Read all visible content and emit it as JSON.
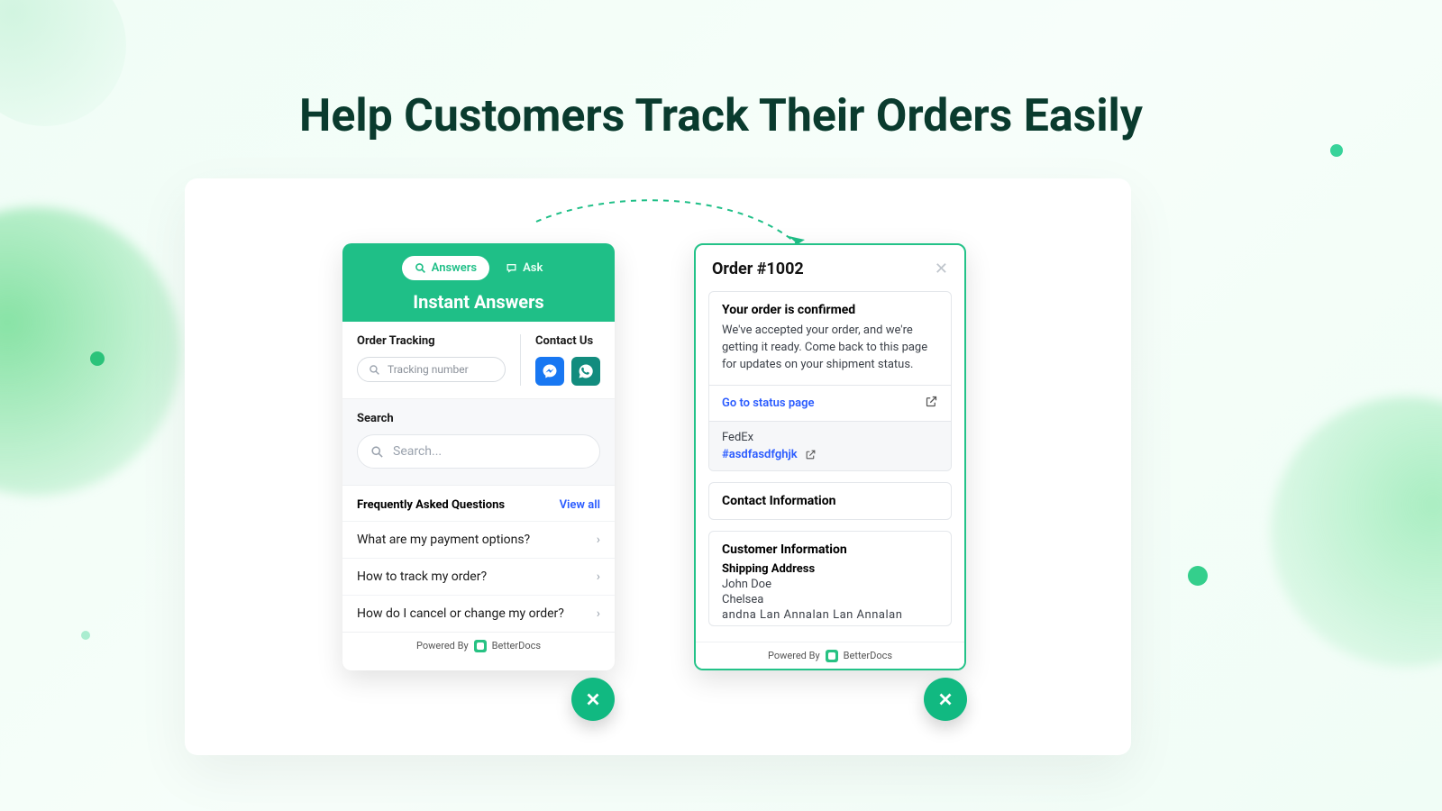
{
  "headline": "Help Customers Track Their Orders Easily",
  "left": {
    "tab_answers": "Answers",
    "tab_ask": "Ask",
    "title": "Instant Answers",
    "tracking_label": "Order Tracking",
    "tracking_placeholder": "Tracking number",
    "contact_label": "Contact Us",
    "search_label": "Search",
    "search_placeholder": "Search...",
    "faq_title": "Frequently Asked Questions",
    "faq_view_all": "View all",
    "faq_items": [
      "What are my payment options?",
      "How to track my order?",
      "How do I cancel or change my order?"
    ]
  },
  "right": {
    "order_title": "Order #1002",
    "confirm_title": "Your order is confirmed",
    "confirm_body": "We've accepted your order, and we're getting it ready. Come back to this page for updates on your shipment status.",
    "status_link": "Go to status page",
    "carrier": "FedEx",
    "tracking_code": "#asdfasdfghjk",
    "contact_info_title": "Contact Information",
    "customer_info_title": "Customer Information",
    "shipping_label": "Shipping Address",
    "ship_name": "John Doe",
    "ship_line1": "Chelsea",
    "ship_line2_partial": "andna  Lan Annalan  Lan Annalan"
  },
  "footer": {
    "powered_by": "Powered By",
    "brand": "BetterDocs"
  }
}
